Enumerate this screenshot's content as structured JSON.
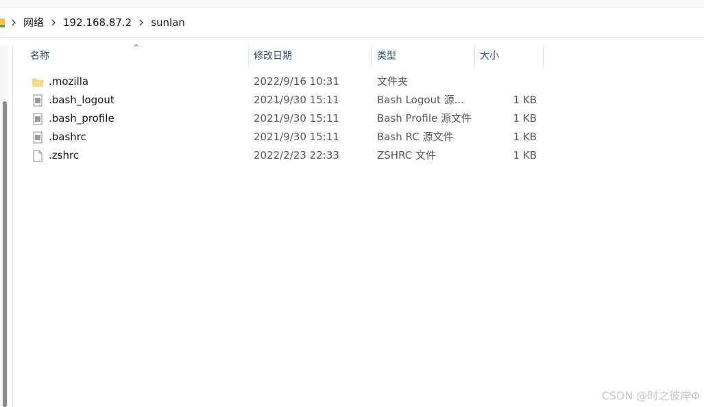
{
  "breadcrumb": {
    "items": [
      "网络",
      "192.168.87.2",
      "sunlan"
    ]
  },
  "columns": {
    "name": "名称",
    "modified": "修改日期",
    "type": "类型",
    "size": "大小"
  },
  "files": [
    {
      "name": ".mozilla",
      "modified": "2022/9/16 10:31",
      "type": "文件夹",
      "size": "",
      "icon": "folder-icon"
    },
    {
      "name": ".bash_logout",
      "modified": "2021/9/30 15:11",
      "type": "Bash Logout 源...",
      "size": "1 KB",
      "icon": "text-file-icon"
    },
    {
      "name": ".bash_profile",
      "modified": "2021/9/30 15:11",
      "type": "Bash Profile 源文件",
      "size": "1 KB",
      "icon": "text-file-icon"
    },
    {
      "name": ".bashrc",
      "modified": "2021/9/30 15:11",
      "type": "Bash RC 源文件",
      "size": "1 KB",
      "icon": "text-file-icon"
    },
    {
      "name": ".zshrc",
      "modified": "2022/2/23 22:33",
      "type": "ZSHRC 文件",
      "size": "1 KB",
      "icon": "blank-file-icon"
    }
  ],
  "watermark": "CSDN @时之彼岸Φ"
}
